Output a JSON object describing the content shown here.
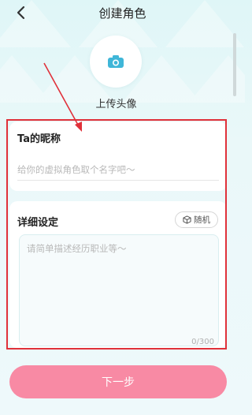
{
  "header": {
    "title": "创建角色",
    "back_icon": "chevron-left-icon"
  },
  "avatar": {
    "label": "上传头像",
    "icon": "camera-icon",
    "icon_color": "#3fb6d8"
  },
  "nickname": {
    "title": "Ta的昵称",
    "placeholder": "给你的虚拟角色取个名字吧～",
    "value": ""
  },
  "details": {
    "title": "详细设定",
    "random_label": "随机",
    "random_icon": "cube-icon",
    "placeholder": "请简单描述经历职业等～",
    "value": "",
    "counter": "0/300"
  },
  "footer": {
    "next_label": "下一步",
    "button_color": "#f88aa4"
  },
  "annotation": {
    "highlight_color": "#e0313a"
  }
}
